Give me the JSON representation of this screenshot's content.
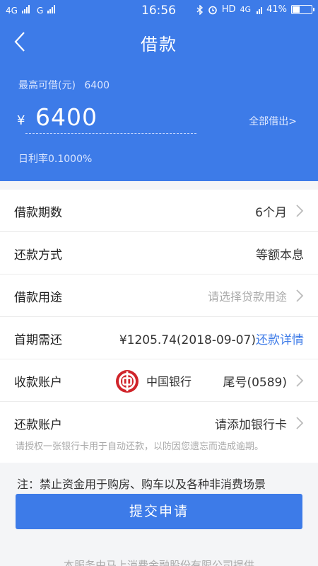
{
  "status_bar": {
    "signal1": "4G",
    "signal2": "G",
    "time": "16:56",
    "hd": "HD",
    "network": "4G",
    "battery_percent": 41,
    "battery_text": "41%"
  },
  "header": {
    "title": "借款"
  },
  "hero": {
    "max_label": "最高可借(元)",
    "max_value": "6400",
    "currency": "¥",
    "amount": "6400",
    "borrow_all": "全部借出>",
    "daily_rate": "日利率0.1000%"
  },
  "rows": {
    "term": {
      "label": "借款期数",
      "value": "6个月"
    },
    "repay_method": {
      "label": "还款方式",
      "value": "等额本息"
    },
    "purpose": {
      "label": "借款用途",
      "placeholder": "请选择贷款用途"
    },
    "first_payment": {
      "label": "首期需还",
      "value": "¥1205.74(2018-09-07)",
      "link": "还款详情"
    },
    "receive_account": {
      "label": "收款账户",
      "bank": "中国银行",
      "tail": "尾号(0589)"
    },
    "repay_account": {
      "label": "还款账户",
      "value": "请添加银行卡",
      "hint": "请授权一张银行卡用于自动还款，以防因您遗忘而造成逾期。"
    }
  },
  "notice": "注：禁止资金用于购房、购车以及各种非消费场景",
  "submit_label": "提交申请",
  "footer": "本服务由马上消费金融股份有限公司提供",
  "colors": {
    "brand": "#3d7be8",
    "bank_red": "#d0242a"
  }
}
